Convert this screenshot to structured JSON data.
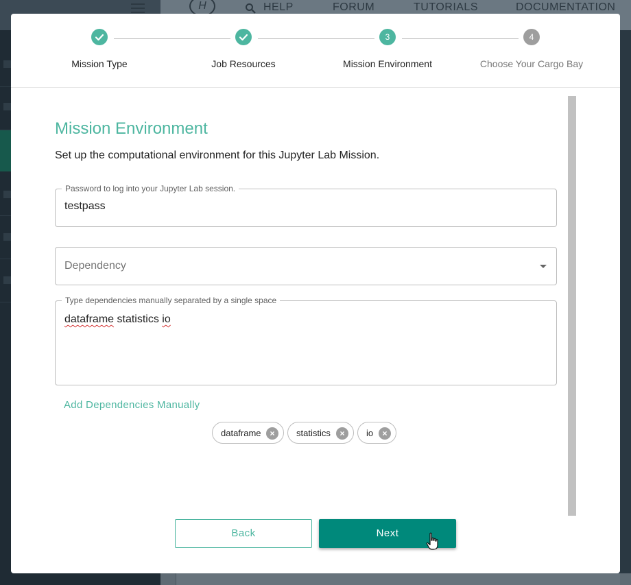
{
  "background": {
    "nav": [
      "HELP",
      "FORUM",
      "TUTORIALS",
      "DOCUMENTATION"
    ],
    "logo": "H"
  },
  "stepper": {
    "steps": [
      {
        "number": "1",
        "label": "Mission Type",
        "state": "done"
      },
      {
        "number": "2",
        "label": "Job Resources",
        "state": "done"
      },
      {
        "number": "3",
        "label": "Mission Environment",
        "state": "active"
      },
      {
        "number": "4",
        "label": "Choose Your Cargo Bay",
        "state": "todo"
      }
    ]
  },
  "main": {
    "title": "Mission Environment",
    "subtitle": "Set up the computational environment for this Jupyter Lab Mission.",
    "password": {
      "legend": "Password to log into your Jupyter Lab session.",
      "value": "testpass"
    },
    "dependency": {
      "placeholder": "Dependency"
    },
    "manual": {
      "legend": "Type dependencies manually separated by a single space",
      "words": [
        "dataframe",
        "statistics",
        "io"
      ]
    },
    "add_manual_label": "Add Dependencies Manually",
    "chips": [
      "dataframe",
      "statistics",
      "io"
    ]
  },
  "actions": {
    "back_label": "Back",
    "next_label": "Next"
  },
  "colors": {
    "accent": "#4db6a0",
    "primary_button": "#00897b",
    "todo_step": "#9e9e9e"
  }
}
